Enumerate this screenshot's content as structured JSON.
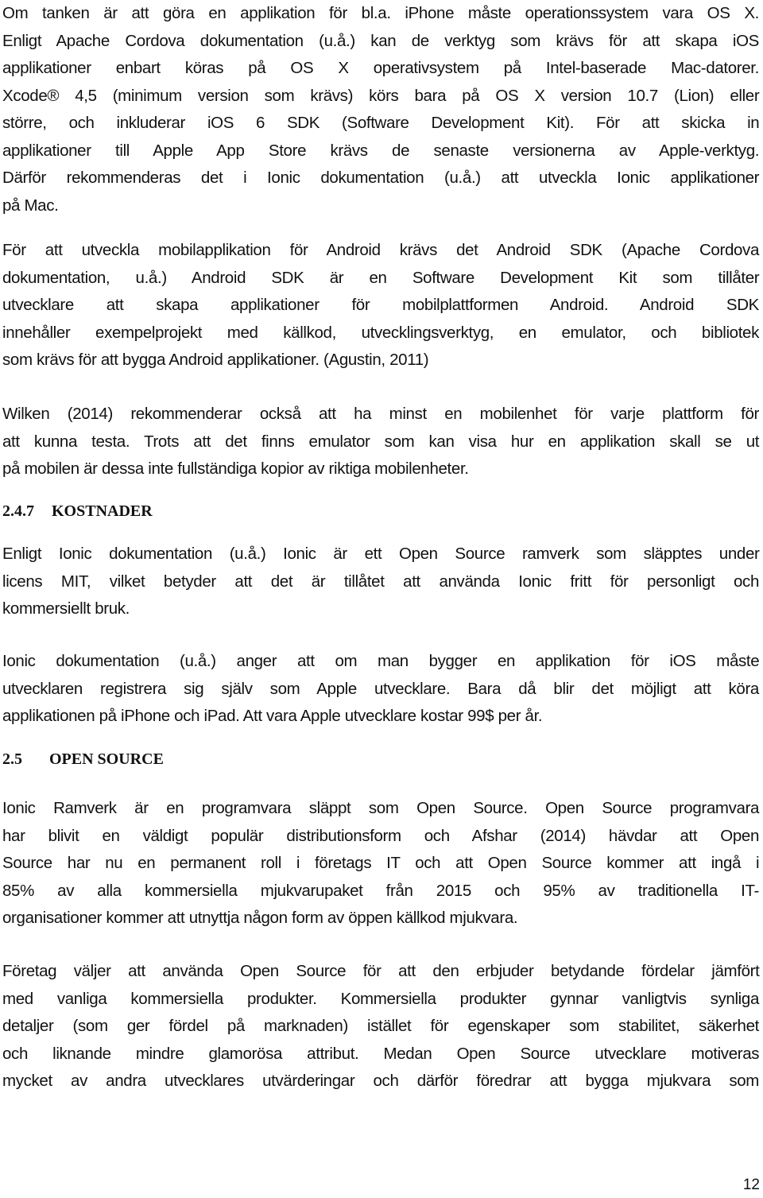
{
  "document": {
    "paragraphs": [
      {
        "id": "ios-requirements",
        "lines": [
          "Om tanken är att göra en applikation för bl.a. iPhone måste operationssystem vara OS X.",
          "Enligt Apache Cordova dokumentation (u.å.) kan de verktyg som krävs för att skapa iOS",
          "applikationer enbart köras på OS X operativsystem på Intel-baserade Mac-datorer.",
          "Xcode® 4,5 (minimum version som krävs) körs bara på OS X version 10.7 (Lion) eller",
          "större, och inkluderar iOS 6 SDK (Software Development Kit). För att skicka in",
          "applikationer till Apple App Store  krävs de senaste versionerna av Apple-verktyg.",
          "Därför rekommenderas det i Ionic dokumentation (u.å.) att utveckla Ionic applikationer",
          "på Mac."
        ]
      },
      {
        "id": "android-requirements",
        "lines": [
          "För att utveckla mobilapplikation för Android krävs det Android SDK (Apache Cordova",
          "dokumentation, u.å.) Android SDK är en Software Development Kit som tillåter",
          "utvecklare att skapa applikationer för mobilplattformen Android. Android SDK",
          "innehåller exempelprojekt med källkod, utvecklingsverktyg, en emulator, och bibliotek",
          "som krävs för att bygga Android applikationer. (Agustin, 2011)"
        ]
      },
      {
        "id": "testing-devices",
        "lines": [
          "Wilken (2014) rekommenderar också att ha minst en mobilenhet för varje plattform för",
          "att kunna testa. Trots att det finns emulator som kan visa hur en applikation skall se ut",
          "på mobilen är dessa inte fullständiga kopior av riktiga mobilenheter."
        ]
      },
      {
        "id": "license",
        "lines": [
          "Enligt Ionic dokumentation (u.å.) Ionic är ett Open Source ramverk som släpptes under",
          "licens MIT, vilket betyder att det är tillåtet att använda Ionic fritt för personligt och",
          "kommersiellt bruk."
        ]
      },
      {
        "id": "apple-developer-cost",
        "lines": [
          "Ionic dokumentation (u.å.) anger att om man bygger en applikation för iOS måste",
          "utvecklaren registrera sig själv som Apple utvecklare. Bara då blir det möjligt att köra",
          "applikationen på iPhone och iPad. Att vara Apple utvecklare kostar 99$ per år."
        ]
      },
      {
        "id": "open-source-intro",
        "lines": [
          "Ionic Ramverk är en programvara släppt som Open Source. Open Source programvara",
          "har blivit en väldigt populär distributionsform och Afshar (2014) hävdar att Open",
          "Source har nu en permanent roll i företags IT och att Open Source kommer att ingå i",
          "85% av alla kommersiella mjukvarupaket från 2015 och 95% av traditionella IT-",
          "organisationer kommer att utnyttja någon form av öppen källkod mjukvara."
        ]
      },
      {
        "id": "open-source-benefits",
        "lines": [
          "Företag väljer att använda Open Source för att den erbjuder betydande fördelar jämfört",
          "med vanliga kommersiella produkter. Kommersiella produkter gynnar vanligtvis synliga",
          "detaljer (som ger fördel på marknaden) istället för egenskaper som stabilitet, säkerhet",
          "och liknande mindre glamorösa attribut. Medan Open Source utvecklare motiveras",
          "mycket av andra utvecklares utvärderingar och därför föredrar att bygga mjukvara som"
        ]
      }
    ],
    "headings": [
      {
        "number": "2.4.7",
        "title": "KOSTNADER"
      },
      {
        "number": "2.5",
        "title": "OPEN SOURCE"
      }
    ],
    "page_number": "12"
  }
}
